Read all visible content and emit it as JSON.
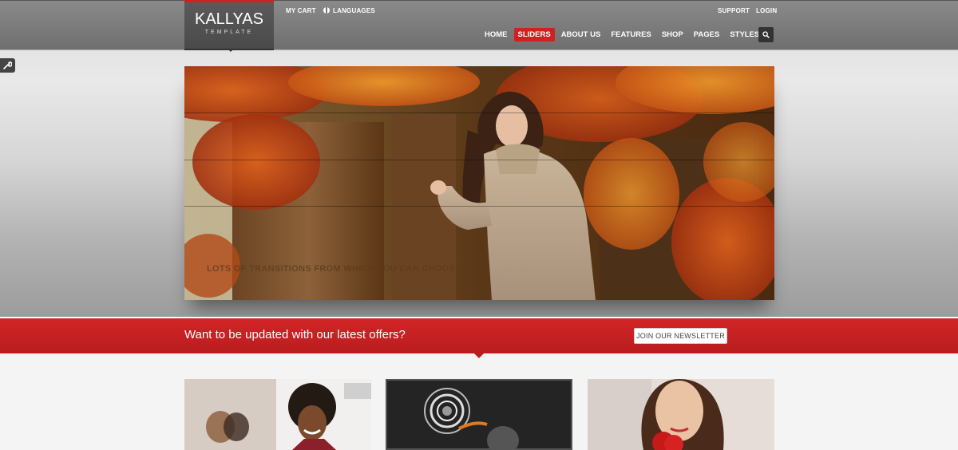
{
  "header": {
    "logo_title": "KALLYAS",
    "logo_subtitle": "TEMPLATE",
    "topbar": {
      "cart_label": "MY CART",
      "languages_label": "LANGUAGES",
      "support_label": "SUPPORT",
      "login_label": "LOGIN"
    },
    "nav": {
      "items": [
        {
          "label": "HOME"
        },
        {
          "label": "SLIDERS",
          "active": true
        },
        {
          "label": "ABOUT US"
        },
        {
          "label": "FEATURES"
        },
        {
          "label": "SHOP"
        },
        {
          "label": "PAGES"
        },
        {
          "label": "STYLES"
        }
      ]
    },
    "accent_color": "#cd2122"
  },
  "slider": {
    "caption": "LOTS OF TRANSITIONS FROM WHICH YOU CAN CHOOSE"
  },
  "newsletter": {
    "text": "Want to be updated with our latest offers?",
    "button_label": "JOIN OUR NEWSLETTER"
  },
  "icons": {
    "search": "search-icon",
    "tool": "wrench-icon",
    "globe": "globe-icon"
  }
}
